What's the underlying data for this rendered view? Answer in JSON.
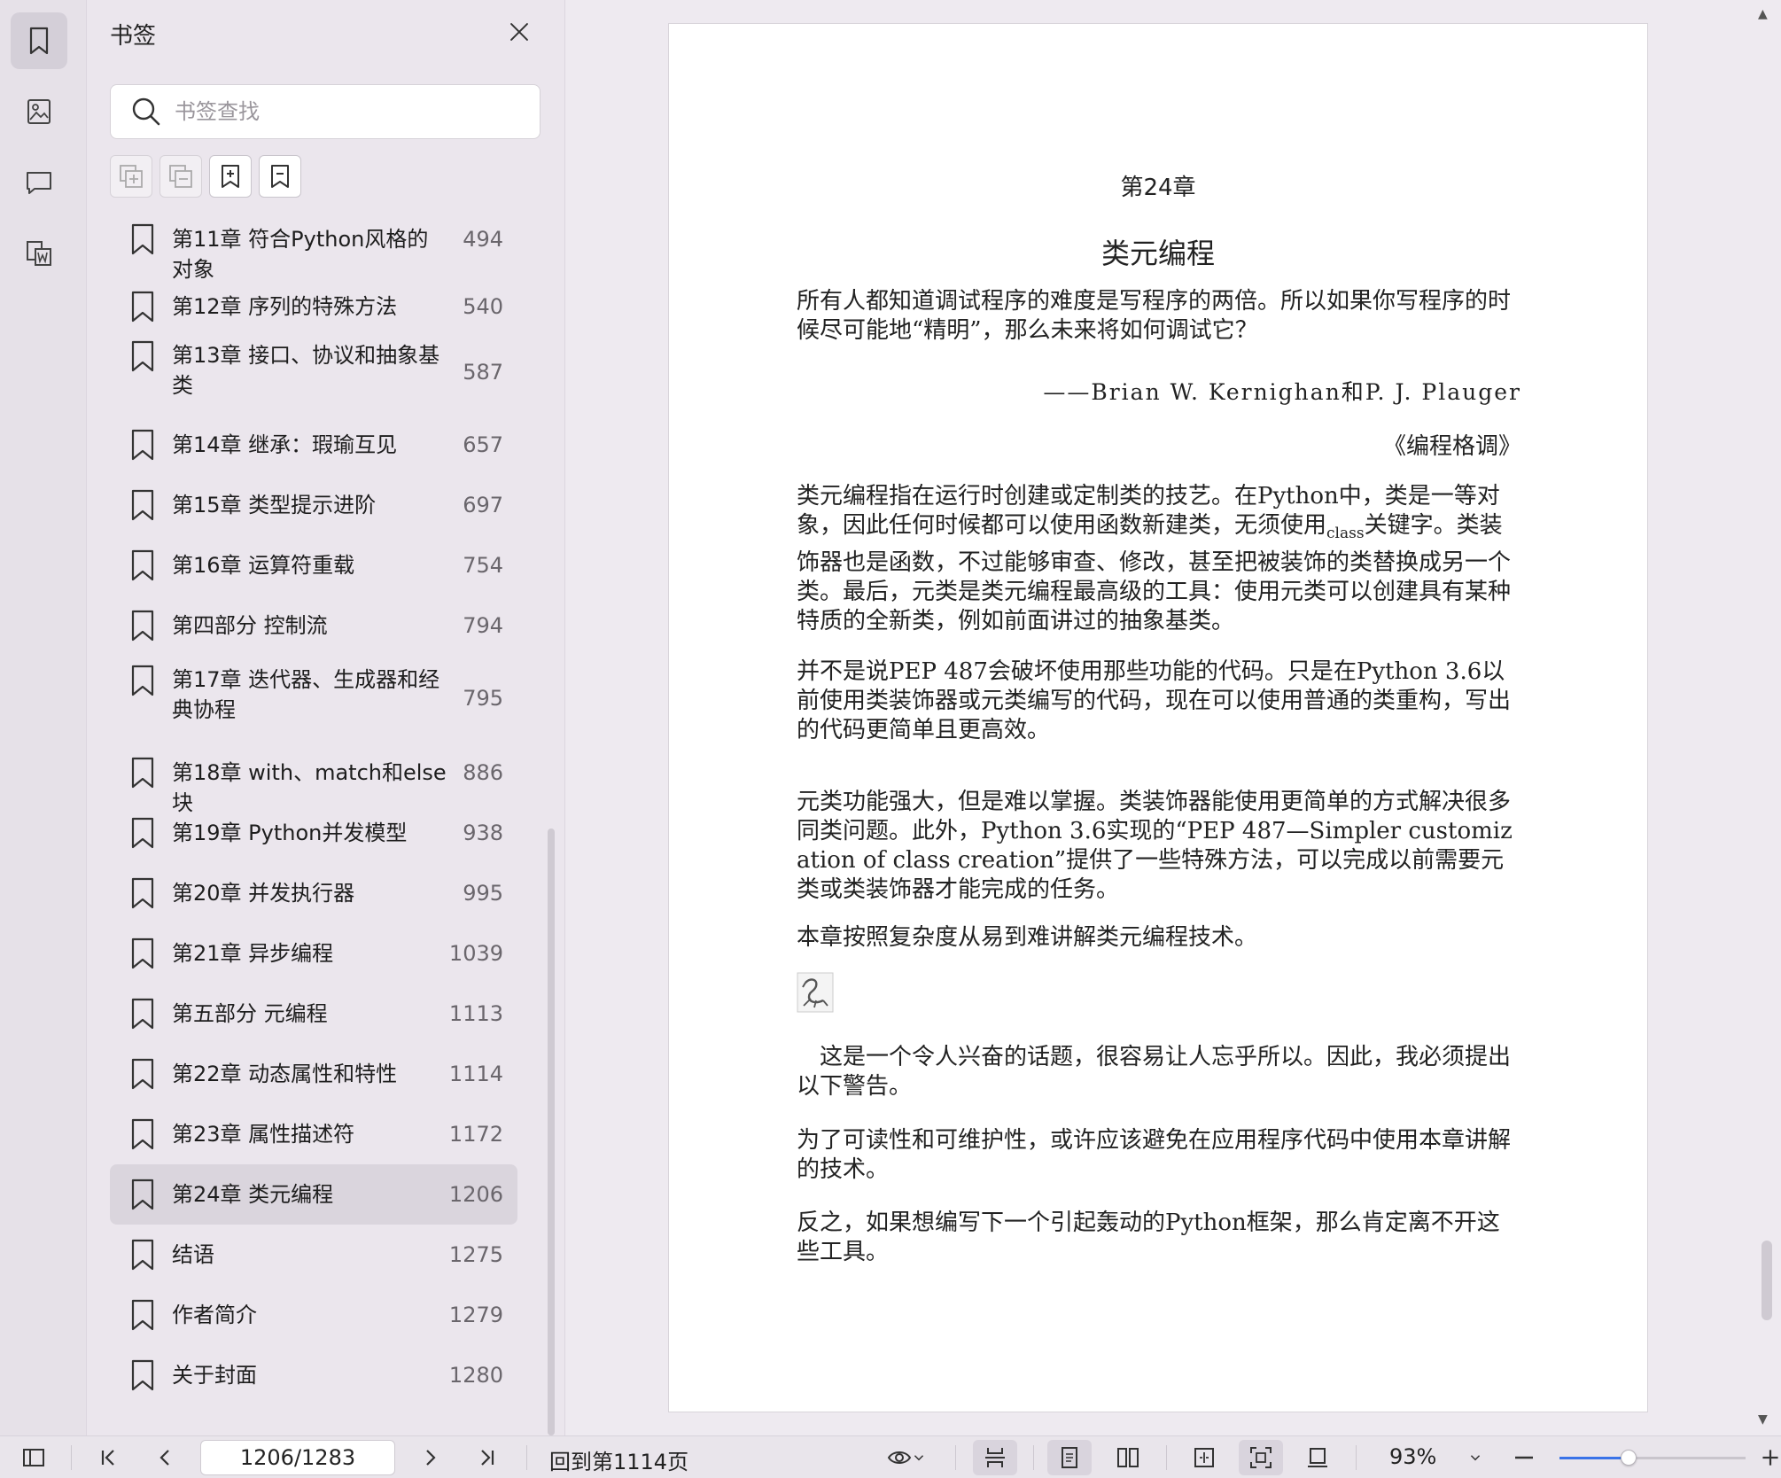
{
  "panel": {
    "title": "书签",
    "search_placeholder": "书签查找"
  },
  "bookmarks": [
    {
      "title": "第11章 符合Python风格的对象",
      "page": "494"
    },
    {
      "title": "第12章 序列的特殊方法",
      "page": "540"
    },
    {
      "title": "第13章 接口、协议和抽象基类",
      "page": "587"
    },
    {
      "title": "第14章 继承：瑕瑜互见",
      "page": "657"
    },
    {
      "title": "第15章 类型提示进阶",
      "page": "697"
    },
    {
      "title": "第16章 运算符重载",
      "page": "754"
    },
    {
      "title": "第四部分 控制流",
      "page": "794"
    },
    {
      "title": "第17章 迭代器、生成器和经典协程",
      "page": "795"
    },
    {
      "title": "第18章 with、match和else块",
      "page": "886"
    },
    {
      "title": "第19章 Python并发模型",
      "page": "938"
    },
    {
      "title": "第20章 并发执行器",
      "page": "995"
    },
    {
      "title": "第21章 异步编程",
      "page": "1039"
    },
    {
      "title": "第五部分 元编程",
      "page": "1113"
    },
    {
      "title": "第22章 动态属性和特性",
      "page": "1114"
    },
    {
      "title": "第23章 属性描述符",
      "page": "1172"
    },
    {
      "title": "第24章 类元编程",
      "page": "1206"
    },
    {
      "title": "结语",
      "page": "1275"
    },
    {
      "title": "作者简介",
      "page": "1279"
    },
    {
      "title": "关于封面",
      "page": "1280"
    }
  ],
  "document": {
    "chapter_number": "第24章",
    "chapter_title": "类元编程",
    "epigraph": "所有人都知道调试程序的难度是写程序的两倍。所以如果你写程序的时候尽可能地“精明”，那么未来将如何调试它？",
    "epigraph_author": "——Brian W. Kernighan和P. J. Plauger",
    "epigraph_source": "《编程格调》",
    "p1": "类元编程指在运行时创建或定制类的技艺。在Python中，类是一等对象，因此任何时候都可以使用函数新建类，无须使用",
    "p1_code": "class",
    "p1_rest": "关键字。类装饰器也是函数，不过能够审查、修改，甚至把被装饰的类替换成另一个类。最后，元类是类元编程最高级的工具：使用元类可以创建具有某种特质的全新类，例如前面讲过的抽象基类。",
    "p2": "并不是说PEP 487会破坏使用那些功能的代码。只是在Python 3.6以前使用类装饰器或元类编写的代码，现在可以使用普通的类重构，写出的代码更简单且更高效。",
    "p3": "元类功能强大，但是难以掌握。类装饰器能使用更简单的方式解决很多同类问题。此外，Python 3.6实现的“PEP 487—Simpler customization of class creation”提供了一些特殊方法，可以完成以前需要元类或类装饰器才能完成的任务。",
    "p4": "本章按照复杂度从易到难讲解类元编程技术。",
    "warning": "这是一个令人兴奋的话题，很容易让人忘乎所以。因此，我必须提出以下警告。",
    "p5": "为了可读性和可维护性，或许应该避免在应用程序代码中使用本章讲解的技术。",
    "p6": "反之，如果想编写下一个引起轰动的Python框架，那么肯定离不开这些工具。"
  },
  "bottombar": {
    "page_indicator": "1206/1283",
    "back_to_page": "回到第1114页",
    "zoom": "93%",
    "zoom_level": 0.37
  },
  "colors": {
    "accent": "#3a73e8",
    "selected_bg": "#dad5dd"
  }
}
